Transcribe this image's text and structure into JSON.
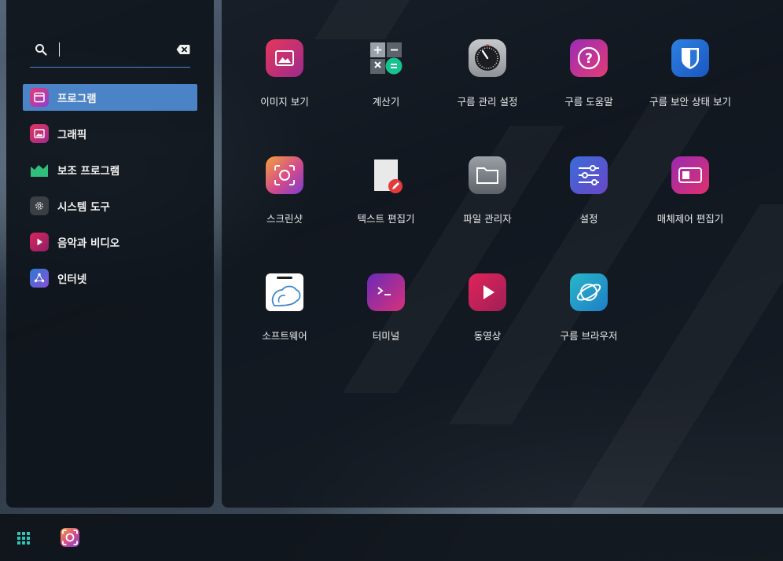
{
  "search": {
    "value": "",
    "placeholder": ""
  },
  "categories": [
    {
      "label": "프로그램",
      "icon": "window-icon",
      "active": true
    },
    {
      "label": "그래픽",
      "icon": "image-icon",
      "active": false
    },
    {
      "label": "보조 프로그램",
      "icon": "chart-area-icon",
      "active": false
    },
    {
      "label": "시스템 도구",
      "icon": "gear-icon",
      "active": false
    },
    {
      "label": "음악과 비디오",
      "icon": "play-icon",
      "active": false
    },
    {
      "label": "인터넷",
      "icon": "network-icon",
      "active": false
    }
  ],
  "apps": [
    {
      "label": "이미지 보기",
      "icon": "image-viewer-icon"
    },
    {
      "label": "계산기",
      "icon": "calculator-icon"
    },
    {
      "label": "구름 관리 설정",
      "icon": "dial-icon"
    },
    {
      "label": "구름 도움말",
      "icon": "help-icon"
    },
    {
      "label": "구름 보안 상태 보기",
      "icon": "shield-icon"
    },
    {
      "label": "스크린샷",
      "icon": "screenshot-icon"
    },
    {
      "label": "텍스트 편집기",
      "icon": "text-editor-icon"
    },
    {
      "label": "파일 관리자",
      "icon": "folder-icon"
    },
    {
      "label": "설정",
      "icon": "sliders-icon"
    },
    {
      "label": "매체제어 편집기",
      "icon": "media-control-icon"
    },
    {
      "label": "소프트웨어",
      "icon": "software-icon"
    },
    {
      "label": "터미널",
      "icon": "terminal-icon"
    },
    {
      "label": "동영상",
      "icon": "video-icon"
    },
    {
      "label": "구름 브라우저",
      "icon": "browser-icon"
    }
  ],
  "taskbar": {
    "launcher_icon": "app-grid-icon",
    "running_app_icon": "screenshot-icon"
  },
  "colors": {
    "accent": "#4b83c7",
    "search_underline": "#4a88d6"
  }
}
